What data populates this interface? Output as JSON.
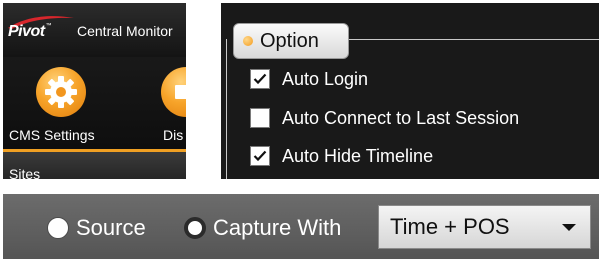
{
  "central_monitor": {
    "logo_text": "Pivot",
    "logo_trademark": "™",
    "app_title": "Central Monitor",
    "toolbar": [
      {
        "label": "CMS Settings",
        "icon": "gear-icon"
      },
      {
        "label": "Dis",
        "icon": "display-icon"
      }
    ],
    "sites_label": "Sites",
    "colors": {
      "accent": "#f0a023",
      "logo_swoosh": "#d8262c"
    }
  },
  "option_panel": {
    "tab_label": "Option",
    "options": [
      {
        "label": "Auto Login",
        "checked": true
      },
      {
        "label": "Auto Connect to Last Session",
        "checked": false
      },
      {
        "label": "Auto Hide Timeline",
        "checked": true
      }
    ]
  },
  "capture_bar": {
    "radios": [
      {
        "label": "Source",
        "selected": false
      },
      {
        "label": "Capture With",
        "selected": true
      }
    ],
    "select_value": "Time + POS"
  }
}
